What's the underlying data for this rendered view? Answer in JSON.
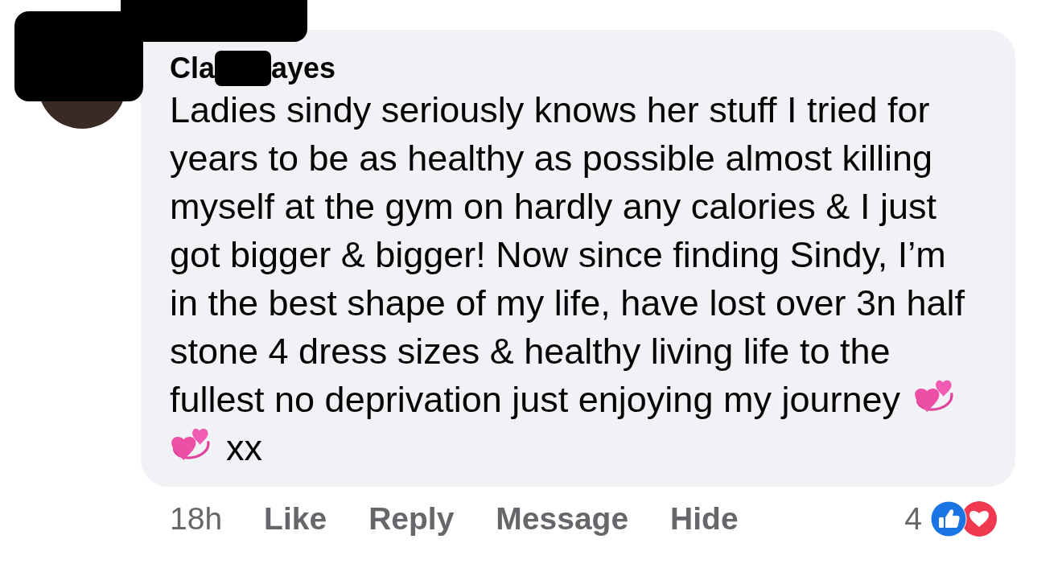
{
  "comment": {
    "author_visible_start": "Cla",
    "author_visible_end": "ayes",
    "lines": [
      [
        {
          "kind": "text",
          "text": "Ladies sindy seriously knows her stuff I tried for"
        }
      ],
      [
        {
          "kind": "text",
          "text": "years to be as healthy as possible almost killing"
        }
      ],
      [
        {
          "kind": "text",
          "text": "myself at the gym on hardly any calories & I just"
        }
      ],
      [
        {
          "kind": "text",
          "text": "got bigger & bigger! Now since finding Sindy, I’m"
        }
      ],
      [
        {
          "kind": "text",
          "text": "in the best shape of my life, have lost over 3n half"
        }
      ],
      [
        {
          "kind": "text",
          "text": "stone 4 dress sizes & healthy living life to the"
        }
      ],
      [
        {
          "kind": "text",
          "text": "fullest no deprivation just enjoying my journey"
        },
        {
          "kind": "emoji"
        }
      ],
      [
        {
          "kind": "emoji"
        },
        {
          "kind": "text",
          "text": "xx"
        }
      ]
    ]
  },
  "footer": {
    "time": "18h",
    "actions": [
      "Like",
      "Reply",
      "Message",
      "Hide"
    ],
    "reaction_count": "4",
    "reactions": [
      {
        "kind": "like"
      },
      {
        "kind": "love"
      }
    ]
  }
}
